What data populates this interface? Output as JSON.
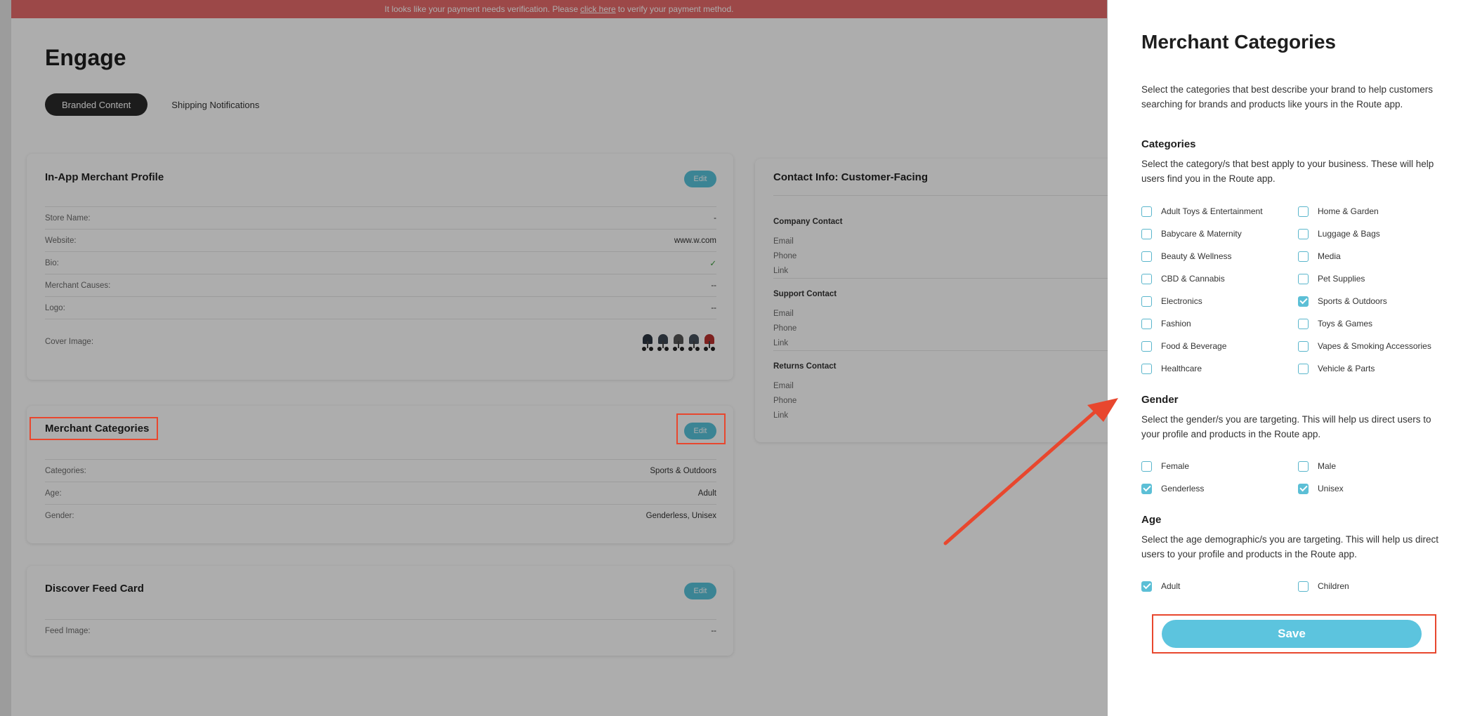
{
  "banner": {
    "text_before": "It looks like your payment needs verification. Please",
    "link": "click here",
    "text_after": "to verify your payment method."
  },
  "page": {
    "title": "Engage",
    "tabs": [
      {
        "label": "Branded Content",
        "active": true
      },
      {
        "label": "Shipping Notifications",
        "active": false
      }
    ]
  },
  "profile_card": {
    "title": "In-App Merchant Profile",
    "edit_label": "Edit",
    "rows": [
      {
        "label": "Store Name:",
        "value": "-"
      },
      {
        "label": "Website:",
        "value": "www.w.com"
      },
      {
        "label": "Bio:",
        "value": "✓"
      },
      {
        "label": "Merchant Causes:",
        "value": "--"
      },
      {
        "label": "Logo:",
        "value": "--"
      }
    ],
    "cover_label": "Cover Image:"
  },
  "categories_card": {
    "title": "Merchant Categories",
    "edit_label": "Edit",
    "rows": [
      {
        "label": "Categories:",
        "value": "Sports & Outdoors"
      },
      {
        "label": "Age:",
        "value": "Adult"
      },
      {
        "label": "Gender:",
        "value": "Genderless, Unisex"
      }
    ]
  },
  "feed_card": {
    "title": "Discover Feed Card",
    "edit_label": "Edit",
    "rows": [
      {
        "label": "Feed Image:",
        "value": "--"
      }
    ]
  },
  "contact_card": {
    "title": "Contact Info: Customer-Facing",
    "sections": [
      {
        "title": "Company Contact",
        "lines": [
          "Email",
          "Phone",
          "Link"
        ]
      },
      {
        "title": "Support Contact",
        "lines": [
          "Email",
          "Phone",
          "Link"
        ]
      },
      {
        "title": "Returns Contact",
        "lines": [
          "Email",
          "Phone",
          "Link"
        ]
      }
    ]
  },
  "panel": {
    "title": "Merchant Categories",
    "description": "Select the categories that best describe your brand to help customers searching for brands and products like yours in the Route app.",
    "categories": {
      "title": "Categories",
      "description": "Select the category/s that best apply to your business. These will help users find you in the Route app.",
      "left": [
        {
          "label": "Adult Toys & Entertainment",
          "checked": false
        },
        {
          "label": "Babycare & Maternity",
          "checked": false
        },
        {
          "label": "Beauty & Wellness",
          "checked": false
        },
        {
          "label": "CBD & Cannabis",
          "checked": false
        },
        {
          "label": "Electronics",
          "checked": false
        },
        {
          "label": "Fashion",
          "checked": false
        },
        {
          "label": "Food & Beverage",
          "checked": false
        },
        {
          "label": "Healthcare",
          "checked": false
        }
      ],
      "right": [
        {
          "label": "Home & Garden",
          "checked": false
        },
        {
          "label": "Luggage & Bags",
          "checked": false
        },
        {
          "label": "Media",
          "checked": false
        },
        {
          "label": "Pet Supplies",
          "checked": false
        },
        {
          "label": "Sports & Outdoors",
          "checked": true
        },
        {
          "label": "Toys & Games",
          "checked": false
        },
        {
          "label": "Vapes & Smoking Accessories",
          "checked": false
        },
        {
          "label": "Vehicle & Parts",
          "checked": false
        }
      ]
    },
    "gender": {
      "title": "Gender",
      "description": "Select the gender/s you are targeting. This will help us direct users to your profile and products in the Route app.",
      "left": [
        {
          "label": "Female",
          "checked": false
        },
        {
          "label": "Genderless",
          "checked": true
        }
      ],
      "right": [
        {
          "label": "Male",
          "checked": false
        },
        {
          "label": "Unisex",
          "checked": true
        }
      ]
    },
    "age": {
      "title": "Age",
      "description": "Select the age demographic/s you are targeting. This will help us direct users to your profile and products in the Route app.",
      "left": [
        {
          "label": "Adult",
          "checked": true
        }
      ],
      "right": [
        {
          "label": "Children",
          "checked": false
        }
      ]
    },
    "save_label": "Save"
  },
  "colors": {
    "accent": "#5cc4de",
    "banner": "#e66b6b",
    "annotation": "#e8472e"
  }
}
